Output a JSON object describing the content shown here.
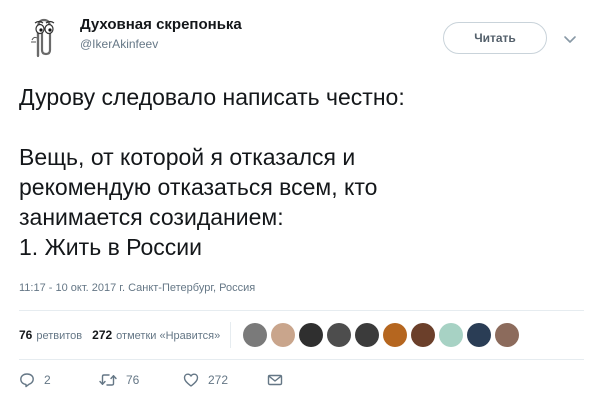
{
  "author": {
    "display_name": "Духовная скрепонька",
    "handle": "@IkerAkinfeev"
  },
  "follow_button": {
    "label": "Читать"
  },
  "tweet": {
    "text": "Дурову следовало написать честно:\n\nВещь, от которой я отказался и\nрекомендую отказаться всем, кто\nзанимается созиданием:\n1. Жить в России"
  },
  "meta": {
    "timestamp_location": "11:17 - 10 окт. 2017 г. Санкт-Петербург, Россия"
  },
  "stats": {
    "retweets_count": "76",
    "retweets_label": "ретвитов",
    "likes_count": "272",
    "likes_label": "отметки «Нравится»"
  },
  "liker_avatars": [
    {
      "name": "liker-1",
      "color": "#7a7a7a"
    },
    {
      "name": "liker-2",
      "color": "#c9a58c"
    },
    {
      "name": "liker-3",
      "color": "#2f2f2f"
    },
    {
      "name": "liker-4",
      "color": "#4d4d4d"
    },
    {
      "name": "liker-5",
      "color": "#3b3b3b"
    },
    {
      "name": "liker-6",
      "color": "#b5661f"
    },
    {
      "name": "liker-7",
      "color": "#6b3f2a"
    },
    {
      "name": "liker-8",
      "color": "#a7d2c4"
    },
    {
      "name": "liker-9",
      "color": "#2a3d55"
    },
    {
      "name": "liker-10",
      "color": "#8c6b5c"
    }
  ],
  "actions": {
    "replies_count": "2",
    "retweets_count": "76",
    "likes_count": "272"
  },
  "colors": {
    "text_primary": "#14171a",
    "text_secondary": "#657786",
    "border": "#e6ecf0"
  }
}
